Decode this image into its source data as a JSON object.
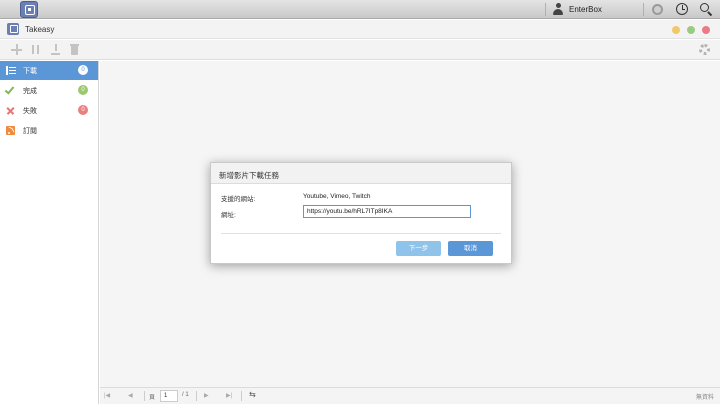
{
  "system_bar": {
    "user": "EnterBox"
  },
  "window": {
    "title": "Takeasy"
  },
  "sidebar": {
    "items": [
      {
        "label": "下載",
        "count": "0"
      },
      {
        "label": "完成",
        "count": "0"
      },
      {
        "label": "失敗",
        "count": "0"
      },
      {
        "label": "訂閱",
        "count": ""
      }
    ]
  },
  "dialog": {
    "title": "新增影片下載任務",
    "supported_label": "支援的網站:",
    "supported_value": "Youtube, Vimeo, Twitch",
    "url_label": "網址:",
    "url_value": "https://youtu.be/hRL7ITp8IKA",
    "next_label": "下一步",
    "cancel_label": "取消"
  },
  "pager": {
    "page_label": "頁",
    "current_page": "1",
    "total_pages": "/ 1",
    "no_data": "無資料"
  },
  "colors": {
    "accent": "#5b97d6",
    "success": "#9bc86d",
    "error": "#ea7f7f",
    "rss": "#f08a3c"
  }
}
